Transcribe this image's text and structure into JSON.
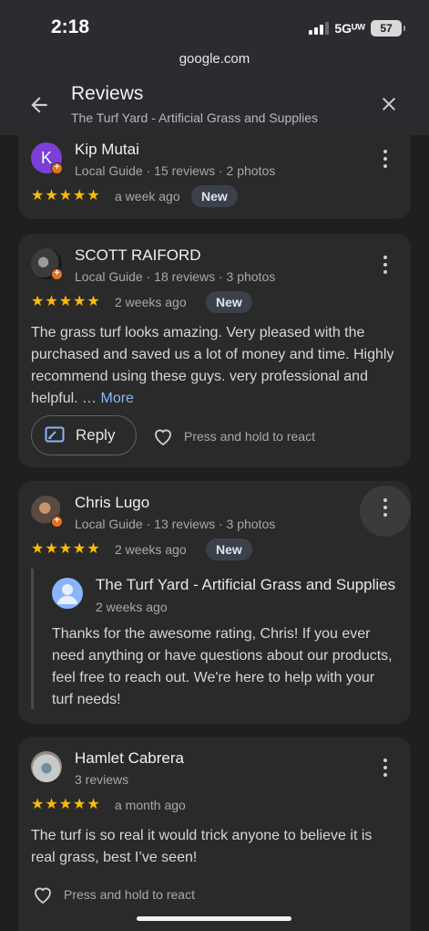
{
  "status_bar": {
    "time": "2:18",
    "network": "5Gᵁᵂ",
    "battery": "57"
  },
  "browser": {
    "url": "google.com"
  },
  "header": {
    "title": "Reviews",
    "subtitle": "The Turf Yard - Artificial Grass and Supplies"
  },
  "reviews": [
    {
      "avatar_initial": "K",
      "avatar_color": "#7b3fd6",
      "name": "Kip Mutai",
      "meta": "Local Guide · 15 reviews · 2 photos",
      "stars": "★★★★★",
      "when": "a week ago",
      "badge": "New"
    },
    {
      "name": "SCOTT RAIFORD",
      "meta": "Local Guide · 18 reviews · 3 photos",
      "stars": "★★★★★",
      "when": "2 weeks ago",
      "badge": "New",
      "text": "The grass turf looks amazing. Very pleased with the purchased and saved us a lot of money and time. Highly recommend using these guys. very professional and helpful. …",
      "more": "More",
      "reply_label": "Reply",
      "react_label": "Press and hold to react"
    },
    {
      "name": "Chris Lugo",
      "meta": "Local Guide · 13 reviews · 3 photos",
      "stars": "★★★★★",
      "when": "2 weeks ago",
      "badge": "New",
      "owner_reply": {
        "name": "The Turf Yard - Artificial Grass and Supplies (Ow",
        "when": "2 weeks ago",
        "text": "Thanks for the awesome rating, Chris! If you ever need anything or have questions about our products, feel free to reach out. We're here to help with your turf needs!"
      }
    },
    {
      "name": "Hamlet Cabrera",
      "meta": "3 reviews",
      "stars": "★★★★★",
      "when": "a month ago",
      "text": "The turf is so real it would trick anyone to believe it is real grass, best I’ve seen!",
      "react_label": "Press and hold to react"
    }
  ],
  "colors": {
    "star": "#fbbc04",
    "link": "#8ab4f8",
    "badge_bg": "#3c4149",
    "guide_badge": "#e8711d"
  }
}
